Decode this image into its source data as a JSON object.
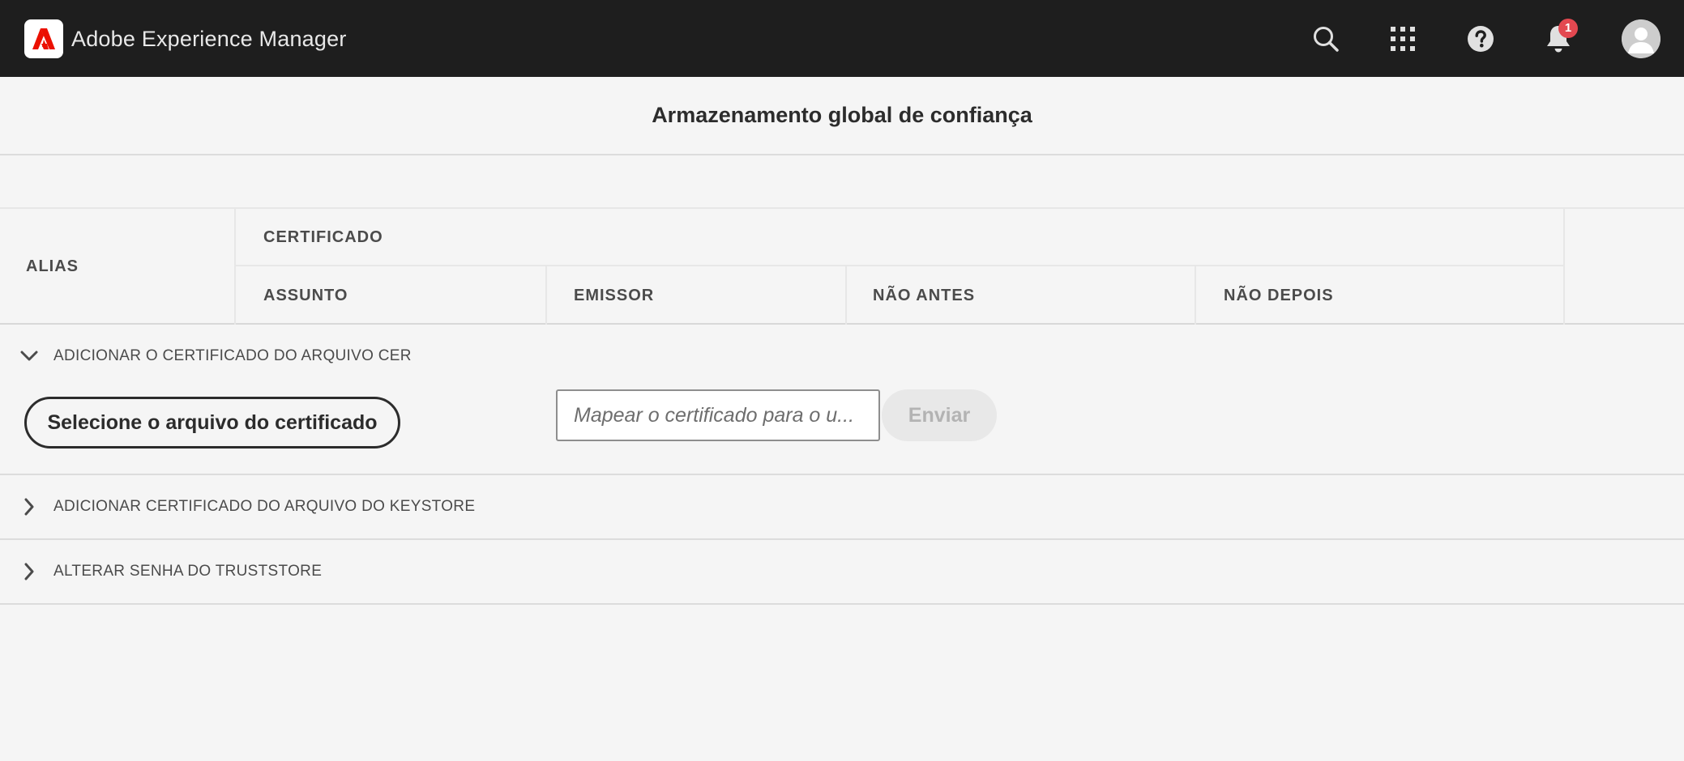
{
  "shell": {
    "app_title": "Adobe Experience Manager",
    "logo_icon": "adobe-logo-icon",
    "icons": [
      "search-icon",
      "apps-grid-icon",
      "help-icon",
      "bell-icon",
      "user-avatar"
    ],
    "notifications_count": "1",
    "colors": {
      "bar": "#1e1e1e",
      "badge": "#e34850",
      "logo_red": "#eb1000"
    }
  },
  "page": {
    "title": "Armazenamento global de confiança"
  },
  "table": {
    "headers": {
      "alias": "ALIAS",
      "certificate_group": "CERTIFICADO",
      "subject": "ASSUNTO",
      "issuer": "EMISSOR",
      "not_before": "NÃO ANTES",
      "not_after": "NÃO DEPOIS"
    },
    "rows": []
  },
  "accordion": {
    "items": [
      {
        "label": "ADICIONAR O CERTIFICADO DO ARQUIVO CER",
        "expanded": true,
        "icon": "chevron-down-icon"
      },
      {
        "label": "ADICIONAR CERTIFICADO DO ARQUIVO DO KEYSTORE",
        "expanded": false,
        "icon": "chevron-right-icon"
      },
      {
        "label": "ALTERAR SENHA DO TRUSTSTORE",
        "expanded": false,
        "icon": "chevron-right-icon"
      }
    ]
  },
  "cer_form": {
    "select_file_label": "Selecione o arquivo do certificado",
    "map_placeholder": "Mapear o certificado para o u...",
    "map_value": "",
    "submit_label": "Enviar",
    "submit_disabled": true
  }
}
